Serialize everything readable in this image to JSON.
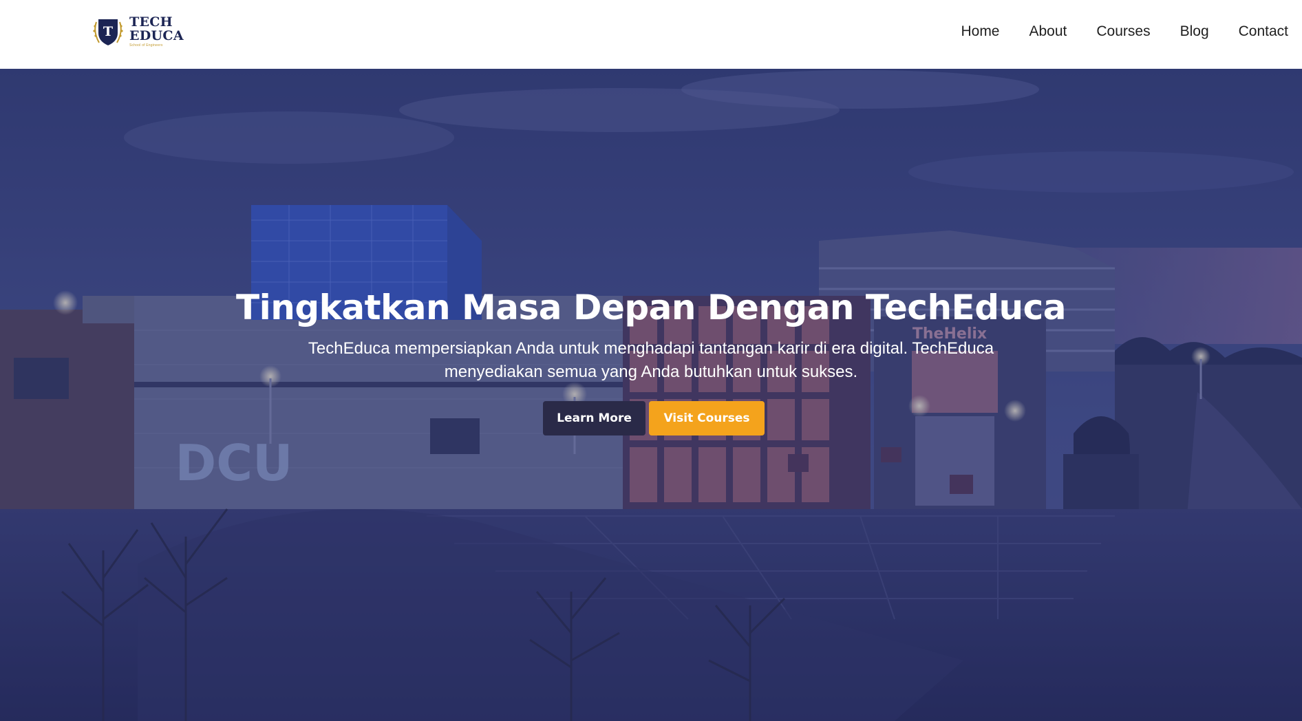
{
  "brand": {
    "line1": "TECH",
    "line2": "EDUCA",
    "tagline": "School of Engineers",
    "shield_letter": "T",
    "colors": {
      "navy": "#1c2554",
      "gold": "#c29a2e"
    }
  },
  "nav": {
    "items": [
      {
        "label": "Home"
      },
      {
        "label": "About"
      },
      {
        "label": "Courses"
      },
      {
        "label": "Blog"
      },
      {
        "label": "Contact"
      }
    ]
  },
  "hero": {
    "title": "Tingkatkan Masa Depan Dengan TechEduca",
    "description": "TechEduca mempersiapkan Anda untuk menghadapi tantangan karir di era digital. TechEduca menyediakan semua yang Anda butuhkan untuk sukses.",
    "primary_button": "Learn More",
    "secondary_button": "Visit Courses",
    "colors": {
      "primary_button": "#2a2a48",
      "secondary_button": "#f4a31c",
      "overlay": "#1e2464"
    }
  },
  "background": {
    "building_sign": "TheHelix",
    "campus_letters": "DCU"
  }
}
